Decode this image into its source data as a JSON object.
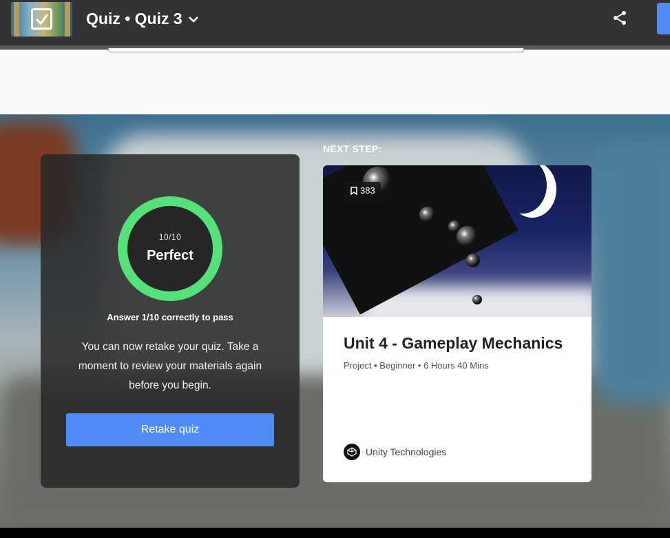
{
  "header": {
    "title": "Quiz • Quiz 3",
    "thumbnail_icon": "checkbox-icon",
    "share_icon": "share-icon"
  },
  "result": {
    "score": "10/10",
    "status": "Perfect",
    "pass_requirement": "Answer 1/10 correctly to pass",
    "message": "You can now retake your quiz. Take a moment to review your materials again before you begin.",
    "retake_label": "Retake quiz",
    "ring_color": "#55e07a",
    "progress": 1.0
  },
  "next_step": {
    "label": "NEXT STEP:",
    "bookmark_count": "383",
    "title": "Unit 4 - Gameplay Mechanics",
    "meta": "Project • Beginner • 6 Hours 40 Mins",
    "author": "Unity Technologies"
  },
  "colors": {
    "accent": "#4f8cf7",
    "header_bg": "#333333"
  }
}
